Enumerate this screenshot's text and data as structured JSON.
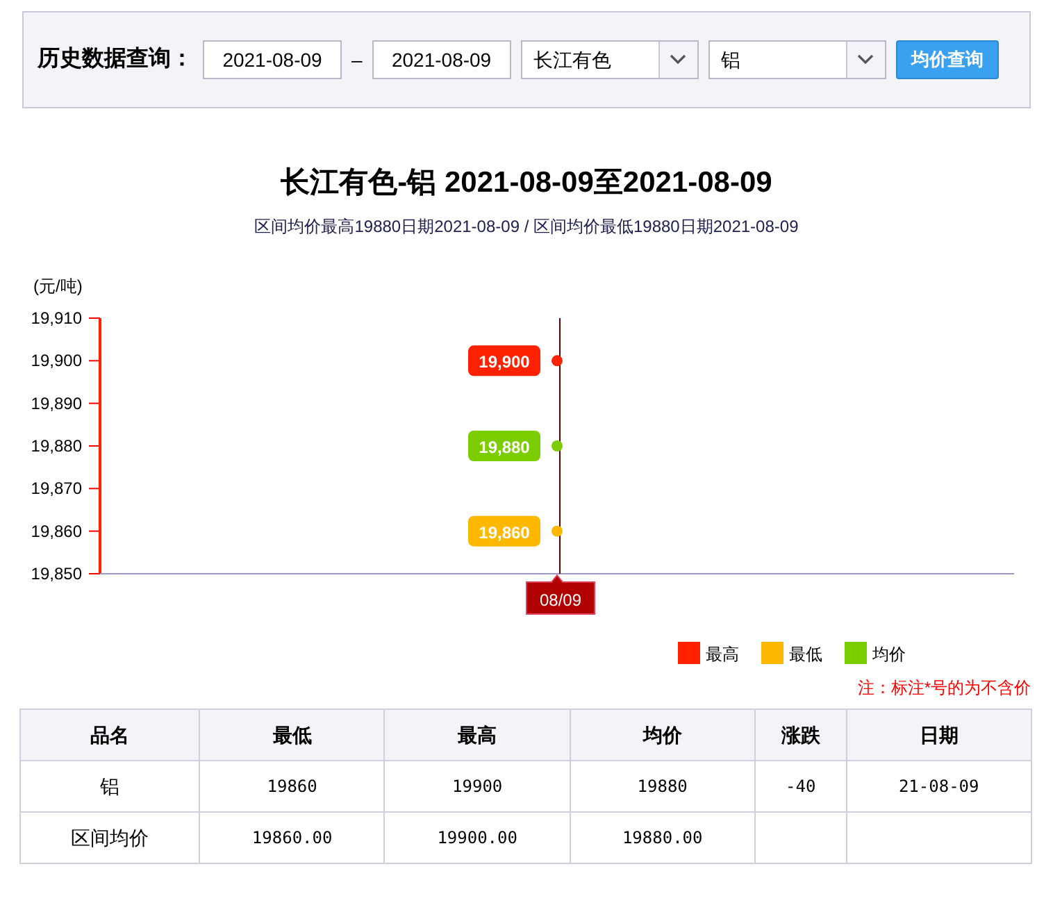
{
  "query": {
    "label": "历史数据查询：",
    "date_from": "2021-08-09",
    "separator": "–",
    "date_to": "2021-08-09",
    "market": "长江有色",
    "metal": "铝",
    "button": "均价查询"
  },
  "chart": {
    "subtitle": "区间均价最高19880日期2021-08-09 / 区间均价最低19880日期2021-08-09",
    "chart_data": {
      "type": "line",
      "title": "长江有色-铝 2021-08-09至2021-08-09",
      "ylabel": "(元/吨)",
      "categories": [
        "08/09"
      ],
      "series": [
        {
          "name": "最高",
          "color": "#ff2200",
          "values": [
            19900
          ],
          "marker": "circle"
        },
        {
          "name": "最低",
          "color": "#ffb800",
          "values": [
            19860
          ],
          "marker": "circle"
        },
        {
          "name": "均价",
          "color": "#7ccd00",
          "values": [
            19880
          ],
          "marker": "circle"
        }
      ],
      "ylim": [
        19850,
        19910
      ],
      "yticks": [
        {
          "value": 19910,
          "label": "19,910"
        },
        {
          "value": 19900,
          "label": "19,900"
        },
        {
          "value": 19890,
          "label": "19,890"
        },
        {
          "value": 19880,
          "label": "19,880"
        },
        {
          "value": 19870,
          "label": "19,870"
        },
        {
          "value": 19860,
          "label": "19,860"
        },
        {
          "value": 19850,
          "label": "19,850"
        }
      ],
      "value_labels": [
        "19,900",
        "19,860",
        "19,880"
      ],
      "legend": "bottom-right",
      "ref_lines": [
        {
          "axis": "x",
          "value": "08/09"
        }
      ]
    }
  },
  "note": "注：标注*号的为不含价",
  "table": {
    "columns": [
      "品名",
      "最低",
      "最高",
      "均价",
      "涨跌",
      "日期"
    ],
    "rows": [
      [
        "铝",
        "19860",
        "19900",
        "19880",
        "-40",
        "21-08-09"
      ],
      [
        "区间均价",
        "19860.00",
        "19900.00",
        "19880.00"
      ]
    ]
  }
}
